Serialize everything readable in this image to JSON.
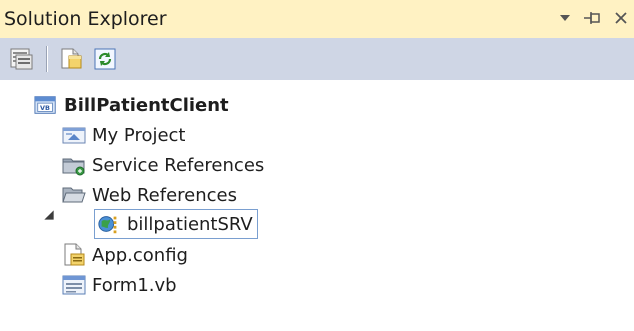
{
  "panel": {
    "title": "Solution Explorer",
    "controls": [
      "dropdown-icon",
      "pin-icon",
      "close-icon"
    ]
  },
  "toolbar": {
    "buttons": [
      "properties-icon",
      "show-all-files-icon",
      "refresh-icon"
    ]
  },
  "tree": {
    "root": {
      "label": "BillPatientClient",
      "icon": "vb-project-icon"
    },
    "items": [
      {
        "label": "My Project",
        "icon": "my-project-icon"
      },
      {
        "label": "Service References",
        "icon": "service-references-icon"
      },
      {
        "label": "Web References",
        "icon": "folder-open-icon",
        "expanded": true
      },
      {
        "label": "billpatientSRV",
        "icon": "web-reference-icon",
        "selected": true
      },
      {
        "label": "App.config",
        "icon": "config-file-icon"
      },
      {
        "label": "Form1.vb",
        "icon": "form-icon"
      }
    ]
  },
  "colors": {
    "title_bg": "#fff2c3",
    "toolbar_bg": "#cfd6e5",
    "selection_border": "#7a9fd0"
  }
}
